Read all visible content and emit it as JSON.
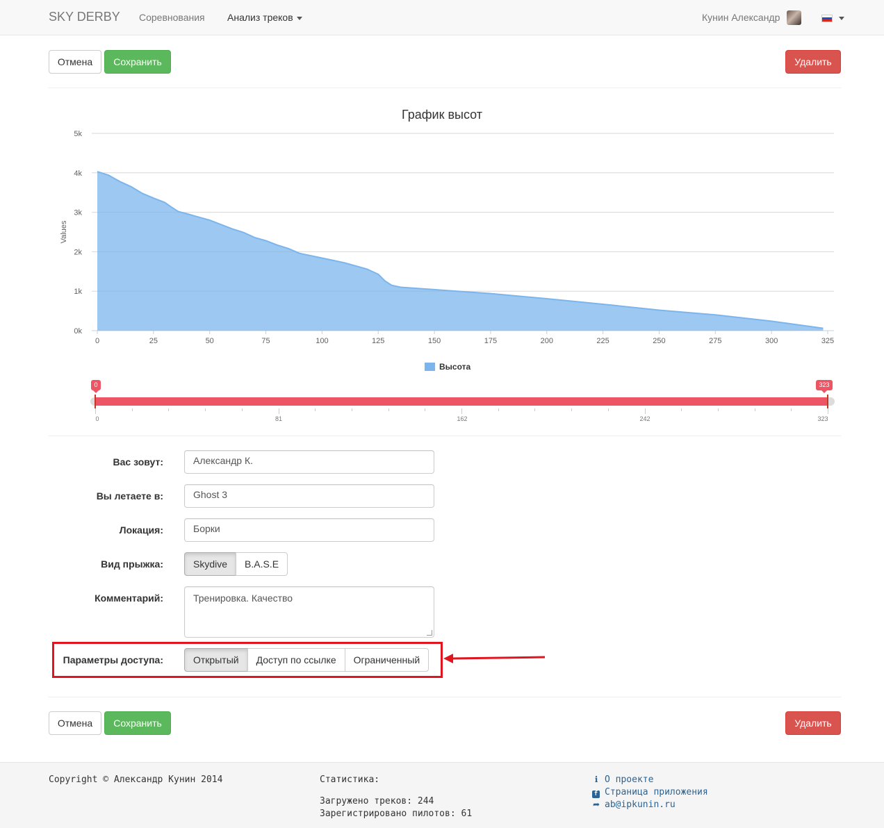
{
  "navbar": {
    "brand": "SKY DERBY",
    "links": [
      "Соревнования",
      "Анализ треков"
    ],
    "user": "Кунин Александр"
  },
  "actions": {
    "cancel": "Отмена",
    "save": "Сохранить",
    "delete": "Удалить"
  },
  "chart_data": {
    "type": "area",
    "title": "График высот",
    "ylabel": "Values",
    "xlabel": "",
    "xlim": [
      0,
      325
    ],
    "ylim": [
      0,
      5000
    ],
    "x_ticks": [
      "0",
      "25",
      "50",
      "75",
      "100",
      "125",
      "150",
      "175",
      "200",
      "225",
      "250",
      "275",
      "300",
      "325"
    ],
    "y_ticks": [
      "0k",
      "1k",
      "2k",
      "3k",
      "4k",
      "5k"
    ],
    "grid": true,
    "legend": "bottom-center",
    "series": [
      {
        "name": "Высота",
        "color": "#7cb5ec",
        "x": [
          0,
          5,
          10,
          15,
          20,
          25,
          30,
          33,
          36,
          40,
          45,
          50,
          55,
          60,
          65,
          70,
          75,
          80,
          85,
          90,
          95,
          100,
          105,
          110,
          115,
          120,
          125,
          128,
          131,
          135,
          140,
          150,
          160,
          175,
          200,
          225,
          250,
          275,
          300,
          323
        ],
        "values": [
          4030,
          3940,
          3780,
          3650,
          3480,
          3360,
          3250,
          3130,
          3020,
          2960,
          2880,
          2800,
          2690,
          2580,
          2490,
          2360,
          2280,
          2170,
          2080,
          1960,
          1900,
          1840,
          1780,
          1720,
          1640,
          1560,
          1430,
          1260,
          1150,
          1100,
          1080,
          1040,
          1000,
          940,
          810,
          670,
          520,
          400,
          240,
          60
        ]
      }
    ]
  },
  "slider": {
    "min_flag": "0",
    "max_flag": "323",
    "tick_labels": [
      "0",
      "81",
      "162",
      "242",
      "323"
    ],
    "from": 0,
    "to": 323,
    "max": 323
  },
  "form": {
    "name_label": "Вас зовут:",
    "name_value": "Александр К.",
    "suit_label": "Вы летаете в:",
    "suit_value": "Ghost 3",
    "location_label": "Локация:",
    "location_value": "Борки",
    "jump_type_label": "Вид прыжка:",
    "jump_types": [
      "Skydive",
      "B.A.S.E"
    ],
    "jump_type_selected": "Skydive",
    "comment_label": "Комментарий:",
    "comment_value": "Тренировка. Качество",
    "access_label": "Параметры доступа:",
    "access_options": [
      "Открытый",
      "Доступ по ссылке",
      "Ограниченный"
    ],
    "access_selected": "Открытый"
  },
  "annotation": {
    "box_color": "#e0151f",
    "arrow_color": "#e0151f"
  },
  "footer": {
    "copyright": "Copyright © Александр Кунин 2014",
    "stats_title": "Статистика:",
    "tracks": "Загружено треков: 244",
    "pilots": "Зарегистрировано пилотов: 61",
    "links": [
      "О проекте",
      "Страница приложения",
      "ab@ipkunin.ru"
    ]
  }
}
